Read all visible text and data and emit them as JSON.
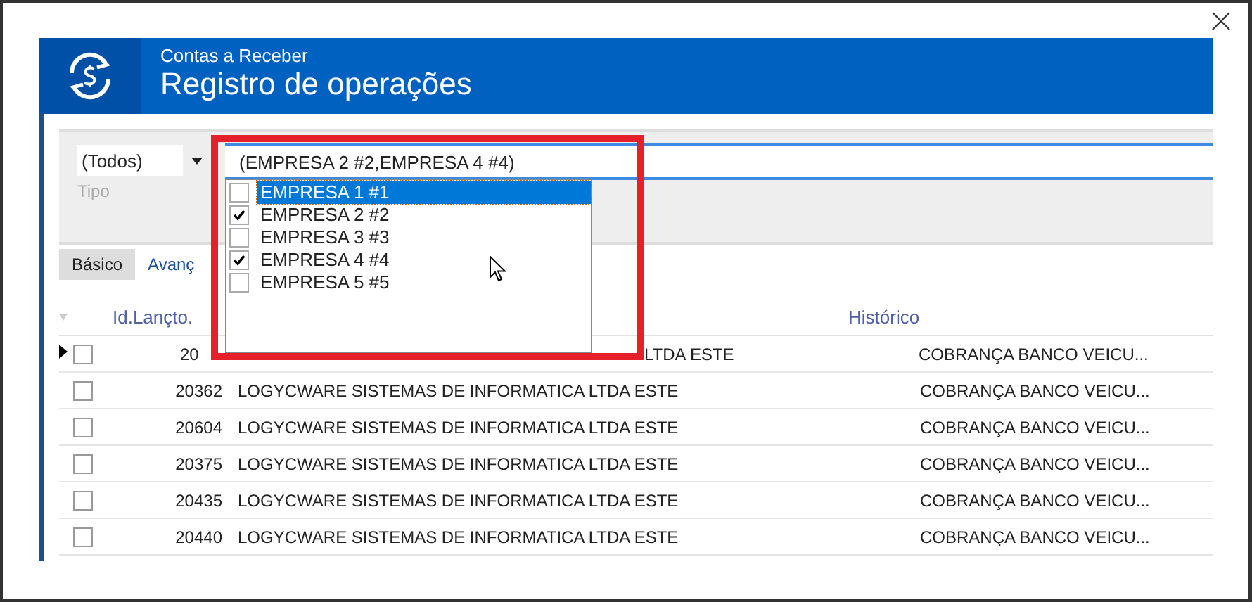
{
  "header": {
    "subtitle": "Contas a Receber",
    "title": "Registro de operações"
  },
  "filter": {
    "tipo_value": "(Todos)",
    "tipo_label": "Tipo",
    "empresa_value": "(EMPRESA 2 #2,EMPRESA 4 #4)"
  },
  "empresa_list": [
    {
      "label": "EMPRESA 1 #1",
      "checked": false,
      "selected": true
    },
    {
      "label": "EMPRESA 2 #2",
      "checked": true,
      "selected": false
    },
    {
      "label": "EMPRESA 3 #3",
      "checked": false,
      "selected": false
    },
    {
      "label": "EMPRESA 4 #4",
      "checked": true,
      "selected": false
    },
    {
      "label": "EMPRESA 5 #5",
      "checked": false,
      "selected": false
    }
  ],
  "tabs": [
    {
      "label": "Básico",
      "selected": true
    },
    {
      "label": "Avanç",
      "selected": false
    }
  ],
  "table": {
    "columns": [
      "Id.Lançto.",
      "Histórico"
    ],
    "rows": [
      {
        "current": true,
        "checked": false,
        "id": "20",
        "name": "LTDA ESTE",
        "historico": "COBRANÇA BANCO VEICU..."
      },
      {
        "current": false,
        "checked": false,
        "id": "20362",
        "name": "LOGYCWARE SISTEMAS DE INFORMATICA LTDA ESTE",
        "historico": "COBRANÇA BANCO VEICU..."
      },
      {
        "current": false,
        "checked": false,
        "id": "20604",
        "name": "LOGYCWARE SISTEMAS DE INFORMATICA LTDA ESTE",
        "historico": "COBRANÇA BANCO VEICU..."
      },
      {
        "current": false,
        "checked": false,
        "id": "20375",
        "name": "LOGYCWARE SISTEMAS DE INFORMATICA LTDA ESTE",
        "historico": "COBRANÇA BANCO VEICU..."
      },
      {
        "current": false,
        "checked": false,
        "id": "20435",
        "name": "LOGYCWARE SISTEMAS DE INFORMATICA LTDA ESTE",
        "historico": "COBRANÇA BANCO VEICU..."
      },
      {
        "current": false,
        "checked": false,
        "id": "20440",
        "name": "LOGYCWARE SISTEMAS DE INFORMATICA LTDA ESTE",
        "historico": "COBRANÇA BANCO VEICU..."
      }
    ]
  }
}
